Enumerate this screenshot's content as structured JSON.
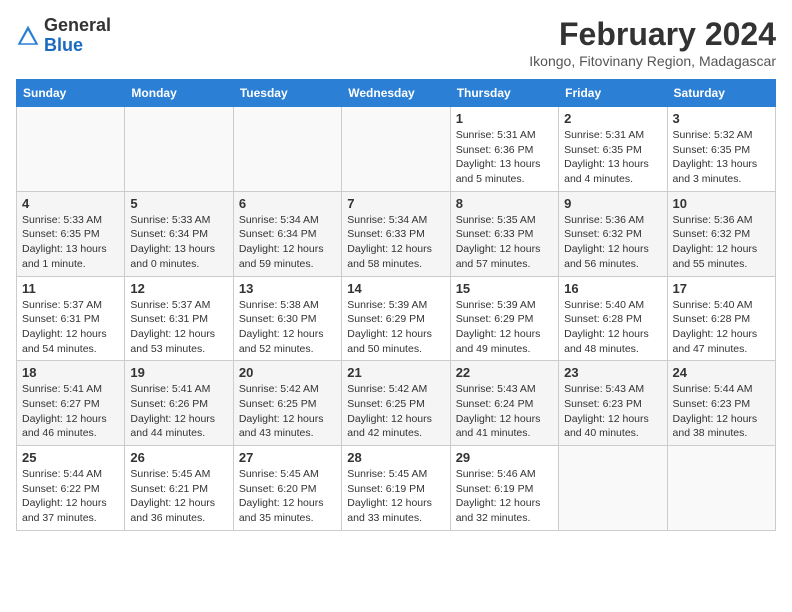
{
  "header": {
    "logo_general": "General",
    "logo_blue": "Blue",
    "month_year": "February 2024",
    "location": "Ikongo, Fitovinany Region, Madagascar"
  },
  "days_of_week": [
    "Sunday",
    "Monday",
    "Tuesday",
    "Wednesday",
    "Thursday",
    "Friday",
    "Saturday"
  ],
  "weeks": [
    [
      {
        "day": "",
        "info": ""
      },
      {
        "day": "",
        "info": ""
      },
      {
        "day": "",
        "info": ""
      },
      {
        "day": "",
        "info": ""
      },
      {
        "day": "1",
        "info": "Sunrise: 5:31 AM\nSunset: 6:36 PM\nDaylight: 13 hours\nand 5 minutes."
      },
      {
        "day": "2",
        "info": "Sunrise: 5:31 AM\nSunset: 6:35 PM\nDaylight: 13 hours\nand 4 minutes."
      },
      {
        "day": "3",
        "info": "Sunrise: 5:32 AM\nSunset: 6:35 PM\nDaylight: 13 hours\nand 3 minutes."
      }
    ],
    [
      {
        "day": "4",
        "info": "Sunrise: 5:33 AM\nSunset: 6:35 PM\nDaylight: 13 hours\nand 1 minute."
      },
      {
        "day": "5",
        "info": "Sunrise: 5:33 AM\nSunset: 6:34 PM\nDaylight: 13 hours\nand 0 minutes."
      },
      {
        "day": "6",
        "info": "Sunrise: 5:34 AM\nSunset: 6:34 PM\nDaylight: 12 hours\nand 59 minutes."
      },
      {
        "day": "7",
        "info": "Sunrise: 5:34 AM\nSunset: 6:33 PM\nDaylight: 12 hours\nand 58 minutes."
      },
      {
        "day": "8",
        "info": "Sunrise: 5:35 AM\nSunset: 6:33 PM\nDaylight: 12 hours\nand 57 minutes."
      },
      {
        "day": "9",
        "info": "Sunrise: 5:36 AM\nSunset: 6:32 PM\nDaylight: 12 hours\nand 56 minutes."
      },
      {
        "day": "10",
        "info": "Sunrise: 5:36 AM\nSunset: 6:32 PM\nDaylight: 12 hours\nand 55 minutes."
      }
    ],
    [
      {
        "day": "11",
        "info": "Sunrise: 5:37 AM\nSunset: 6:31 PM\nDaylight: 12 hours\nand 54 minutes."
      },
      {
        "day": "12",
        "info": "Sunrise: 5:37 AM\nSunset: 6:31 PM\nDaylight: 12 hours\nand 53 minutes."
      },
      {
        "day": "13",
        "info": "Sunrise: 5:38 AM\nSunset: 6:30 PM\nDaylight: 12 hours\nand 52 minutes."
      },
      {
        "day": "14",
        "info": "Sunrise: 5:39 AM\nSunset: 6:29 PM\nDaylight: 12 hours\nand 50 minutes."
      },
      {
        "day": "15",
        "info": "Sunrise: 5:39 AM\nSunset: 6:29 PM\nDaylight: 12 hours\nand 49 minutes."
      },
      {
        "day": "16",
        "info": "Sunrise: 5:40 AM\nSunset: 6:28 PM\nDaylight: 12 hours\nand 48 minutes."
      },
      {
        "day": "17",
        "info": "Sunrise: 5:40 AM\nSunset: 6:28 PM\nDaylight: 12 hours\nand 47 minutes."
      }
    ],
    [
      {
        "day": "18",
        "info": "Sunrise: 5:41 AM\nSunset: 6:27 PM\nDaylight: 12 hours\nand 46 minutes."
      },
      {
        "day": "19",
        "info": "Sunrise: 5:41 AM\nSunset: 6:26 PM\nDaylight: 12 hours\nand 44 minutes."
      },
      {
        "day": "20",
        "info": "Sunrise: 5:42 AM\nSunset: 6:25 PM\nDaylight: 12 hours\nand 43 minutes."
      },
      {
        "day": "21",
        "info": "Sunrise: 5:42 AM\nSunset: 6:25 PM\nDaylight: 12 hours\nand 42 minutes."
      },
      {
        "day": "22",
        "info": "Sunrise: 5:43 AM\nSunset: 6:24 PM\nDaylight: 12 hours\nand 41 minutes."
      },
      {
        "day": "23",
        "info": "Sunrise: 5:43 AM\nSunset: 6:23 PM\nDaylight: 12 hours\nand 40 minutes."
      },
      {
        "day": "24",
        "info": "Sunrise: 5:44 AM\nSunset: 6:23 PM\nDaylight: 12 hours\nand 38 minutes."
      }
    ],
    [
      {
        "day": "25",
        "info": "Sunrise: 5:44 AM\nSunset: 6:22 PM\nDaylight: 12 hours\nand 37 minutes."
      },
      {
        "day": "26",
        "info": "Sunrise: 5:45 AM\nSunset: 6:21 PM\nDaylight: 12 hours\nand 36 minutes."
      },
      {
        "day": "27",
        "info": "Sunrise: 5:45 AM\nSunset: 6:20 PM\nDaylight: 12 hours\nand 35 minutes."
      },
      {
        "day": "28",
        "info": "Sunrise: 5:45 AM\nSunset: 6:19 PM\nDaylight: 12 hours\nand 33 minutes."
      },
      {
        "day": "29",
        "info": "Sunrise: 5:46 AM\nSunset: 6:19 PM\nDaylight: 12 hours\nand 32 minutes."
      },
      {
        "day": "",
        "info": ""
      },
      {
        "day": "",
        "info": ""
      }
    ]
  ]
}
